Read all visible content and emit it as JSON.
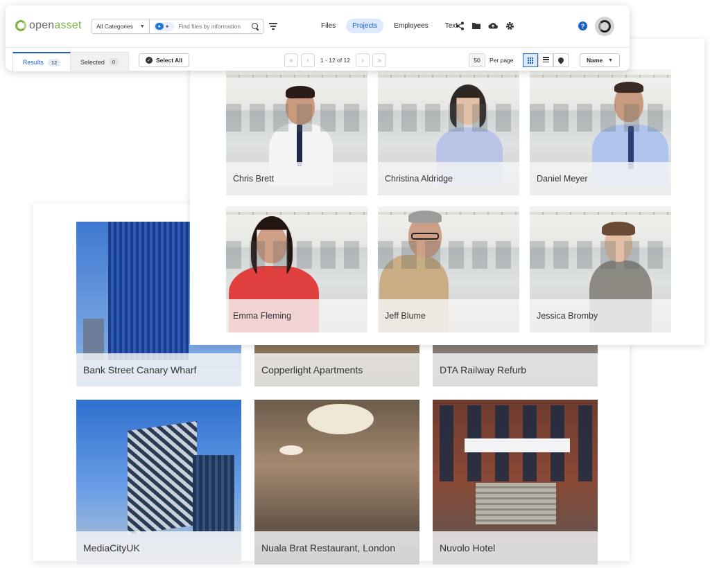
{
  "app": {
    "logo": {
      "open": "open",
      "asset": "asset"
    }
  },
  "search": {
    "category": "All Categories",
    "placeholder": "Find files by information"
  },
  "nav": {
    "tabs": [
      {
        "label": "Files",
        "active": false
      },
      {
        "label": "Projects",
        "active": true
      },
      {
        "label": "Employees",
        "active": false
      },
      {
        "label": "Text",
        "active": false
      }
    ]
  },
  "tools": {
    "icons": [
      "share-icon",
      "folder-icon",
      "cloud-upload-icon",
      "gear-icon"
    ],
    "help": "?"
  },
  "results_bar": {
    "results_label": "Results",
    "results_count": "12",
    "selected_label": "Selected",
    "selected_count": "0",
    "select_all": "Select All",
    "range": "1 - 12 of 12",
    "per_page_value": "50",
    "per_page_label": "Per page",
    "sort": "Name"
  },
  "employees": [
    {
      "name": "Chris Brett"
    },
    {
      "name": "Christina Aldridge"
    },
    {
      "name": "Daniel Meyer"
    },
    {
      "name": "Emma Fleming"
    },
    {
      "name": "Jeff Blume"
    },
    {
      "name": "Jessica Bromby"
    }
  ],
  "projects": [
    {
      "name": "Bank Street Canary Wharf"
    },
    {
      "name": "Copperlight Apartments"
    },
    {
      "name": "DTA Railway Refurb"
    },
    {
      "name": "MediaCityUK"
    },
    {
      "name": "Nuala Brat Restaurant, London"
    },
    {
      "name": "Nuvolo Hotel"
    }
  ],
  "colors": {
    "accent": "#1a62c7",
    "brand_green": "#7cb342"
  }
}
